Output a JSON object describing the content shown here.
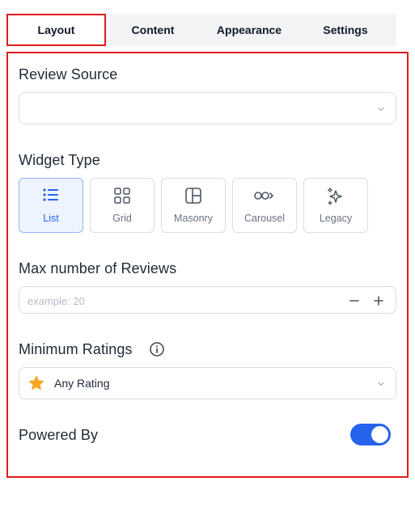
{
  "tabs": [
    {
      "label": "Layout",
      "active": true
    },
    {
      "label": "Content",
      "active": false
    },
    {
      "label": "Appearance",
      "active": false
    },
    {
      "label": "Settings",
      "active": false
    }
  ],
  "review_source": {
    "label": "Review Source",
    "value": ""
  },
  "widget_type": {
    "label": "Widget Type",
    "selected": "List",
    "options": [
      {
        "label": "List",
        "icon": "list-icon"
      },
      {
        "label": "Grid",
        "icon": "grid-icon"
      },
      {
        "label": "Masonry",
        "icon": "masonry-icon"
      },
      {
        "label": "Carousel",
        "icon": "carousel-icon"
      },
      {
        "label": "Legacy",
        "icon": "sparkles-icon"
      }
    ]
  },
  "max_reviews": {
    "label": "Max number of Reviews",
    "placeholder": "example: 20",
    "value": ""
  },
  "minimum_ratings": {
    "label": "Minimum Ratings",
    "value": "Any Rating",
    "icon": "star-icon"
  },
  "powered_by": {
    "label": "Powered By",
    "enabled": true
  },
  "colors": {
    "accent": "#2563eb",
    "highlight_border": "#e01b1b",
    "star": "#f5a623"
  }
}
